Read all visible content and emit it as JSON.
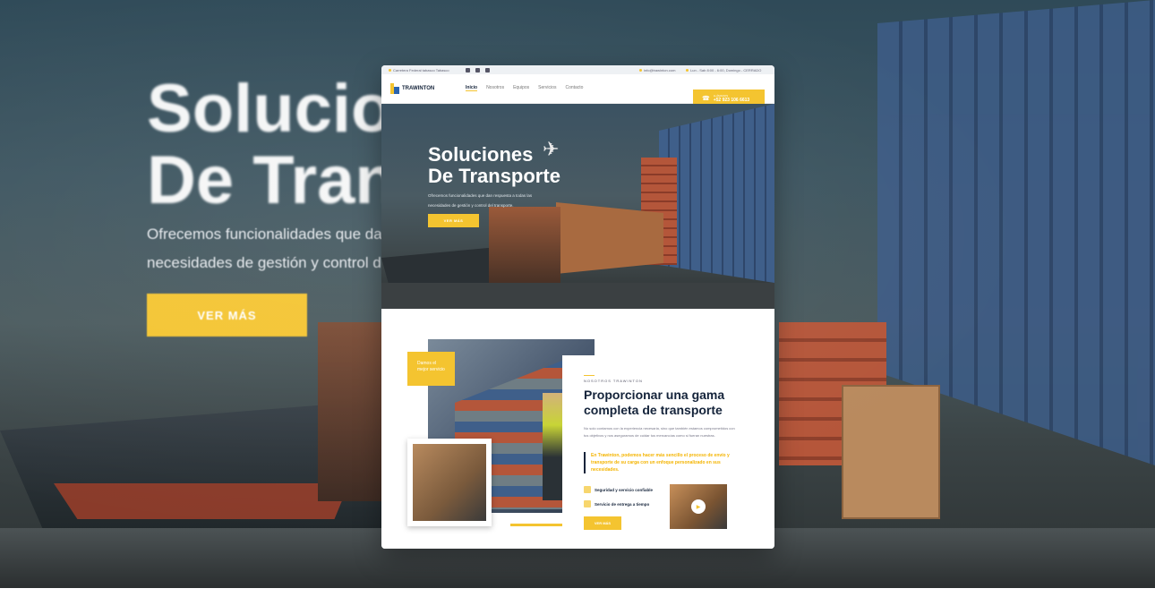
{
  "background": {
    "title": "Solucio\nDe Tran",
    "subtitle": "Ofrecemos funcionalidades que dan\nnecesidades de gestión y control del",
    "button": "VER MÁS"
  },
  "topbar": {
    "address": "Carretera Federal tabasco Tabasco",
    "email": "info@trawinton.com",
    "hours": "Lun - Sab 8:00 - 6:00, Domingo - CERRADO"
  },
  "nav": {
    "logo": "TRAWINTON",
    "links": [
      "Inicio",
      "Nosotros",
      "Equipos",
      "Servicios",
      "Contacto"
    ],
    "call_label": "LLÁMANOS",
    "call_number": "+52 923 106 6613"
  },
  "hero": {
    "title": "Soluciones\nDe Transporte",
    "subtitle": "Ofrecemos funcionalidades que dan respuesta a todas las\nnecesidades de gestión y control del transporte.",
    "button": "VER MÁS"
  },
  "about": {
    "badge": "Damos el\nmejor servicio",
    "label": "NOSOTROS TRAWINTON",
    "title": "Proporcionar una gama completa de transporte",
    "paragraph": "No solo contamos con la experiencia necesaria, sino que también estamos comprometidos con tus objetivos y nos aseguramos de cuidar tus mercancías como si fueran nuestras.",
    "quote": "En Trawinton, podemos hacer más sencillo el proceso de envío y transporte de su carga con un enfoque personalizado en sus necesidades.",
    "features": [
      "Seguridad y servicio confiable",
      "Servicio de entrega a tiempo"
    ],
    "button": "VER MÁS"
  },
  "colors": {
    "accent": "#f4c430",
    "navy": "#14233a"
  }
}
